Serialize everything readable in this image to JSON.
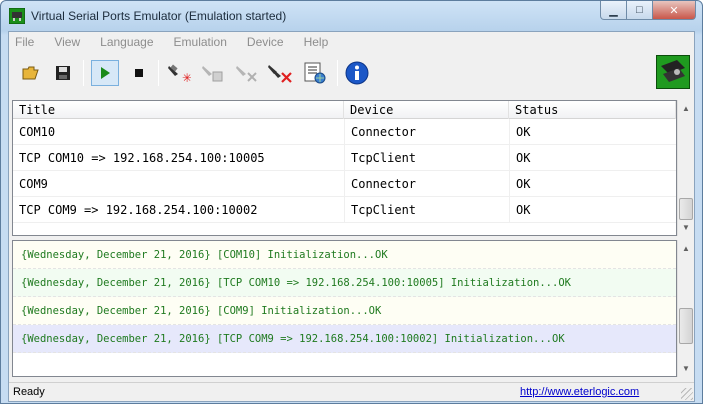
{
  "window": {
    "title": "Virtual Serial Ports Emulator (Emulation started)",
    "min_glyph": "▁",
    "max_glyph": "□",
    "close_glyph": "✕"
  },
  "menu": [
    "File",
    "View",
    "Language",
    "Emulation",
    "Device",
    "Help"
  ],
  "toolbar": {
    "icons": [
      "open-folder-icon",
      "save-icon",
      "play-icon",
      "stop-icon",
      "new-device-icon",
      "edit-device-icon",
      "delete-device-icon",
      "delete-all-icon",
      "settings-icon",
      "info-icon",
      "app-logo-icon"
    ]
  },
  "table": {
    "columns": [
      "Title",
      "Device",
      "Status"
    ],
    "rows": [
      {
        "title": "COM10",
        "device": "Connector",
        "status": "OK"
      },
      {
        "title": "TCP COM10 => 192.168.254.100:10005",
        "device": "TcpClient",
        "status": "OK"
      },
      {
        "title": "COM9",
        "device": "Connector",
        "status": "OK"
      },
      {
        "title": "TCP COM9 => 192.168.254.100:10002",
        "device": "TcpClient",
        "status": "OK"
      }
    ]
  },
  "log": [
    "{Wednesday, December 21, 2016} [COM10] Initialization...OK",
    "{Wednesday, December 21, 2016} [TCP COM10 => 192.168.254.100:10005] Initialization...OK",
    "{Wednesday, December 21, 2016} [COM9] Initialization...OK",
    "{Wednesday, December 21, 2016} [TCP COM9 => 192.168.254.100:10002] Initialization...OK"
  ],
  "status": {
    "text": "Ready",
    "link": "http://www.eterlogic.com"
  },
  "colors": {
    "log_text": "#1f7a1f",
    "log_row_bg_1": "#fefef4",
    "log_row_bg_2": "#f2fcf2",
    "log_row_bg_3": "#fefef4",
    "log_row_bg_4": "#e6e8fb",
    "link": "#0000cc"
  }
}
